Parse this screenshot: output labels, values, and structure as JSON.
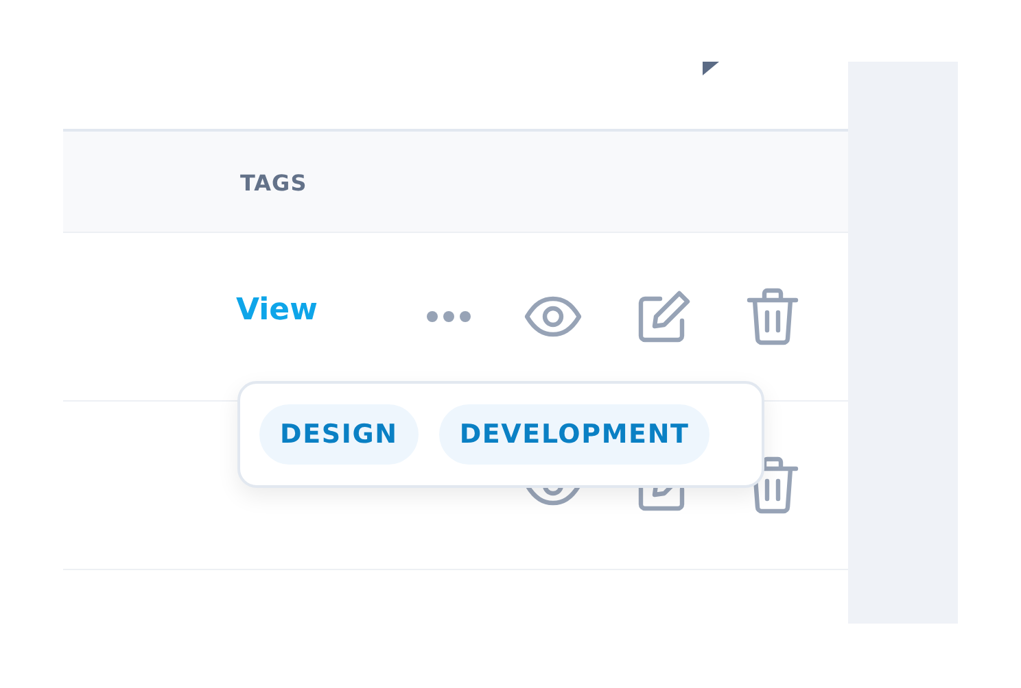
{
  "table": {
    "columns": [
      "TAGS"
    ],
    "rows": [
      {
        "link": "View",
        "actions": [
          {
            "kind": "more"
          },
          {
            "kind": "view"
          },
          {
            "kind": "edit"
          },
          {
            "kind": "delete"
          }
        ]
      },
      {
        "actions": [
          {
            "kind": "view"
          },
          {
            "kind": "edit"
          },
          {
            "kind": "delete"
          }
        ]
      }
    ]
  },
  "popover": {
    "tags": [
      "DESIGN",
      "DEVELOPMENT"
    ]
  }
}
